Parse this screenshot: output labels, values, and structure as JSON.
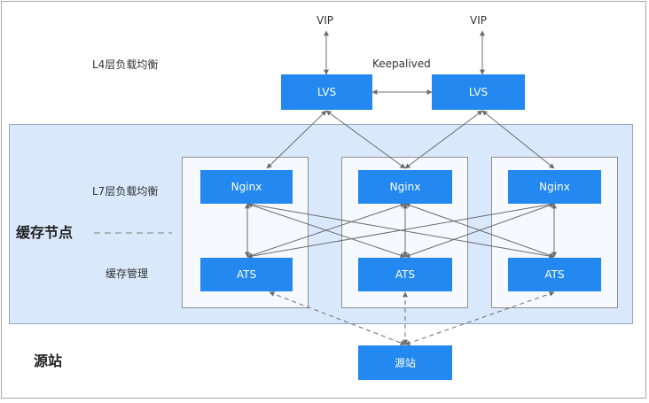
{
  "top": {
    "vip_left": "VIP",
    "vip_right": "VIP",
    "keepalived": "Keepalived",
    "l4_label": "L4层负载均衡"
  },
  "lvs": {
    "left": "LVS",
    "right": "LVS"
  },
  "cache": {
    "section_title": "缓存节点",
    "l7_label": "L7层负载均衡",
    "management_label": "缓存管理",
    "nginx_left": "Nginx",
    "nginx_middle": "Nginx",
    "nginx_right": "Nginx",
    "ats_left": "ATS",
    "ats_middle": "ATS",
    "ats_right": "ATS"
  },
  "origin": {
    "section_title": "源站",
    "box_label": "源站"
  },
  "colors": {
    "box_blue": "#2388f0",
    "panel_blue": "#d9e8fb"
  }
}
